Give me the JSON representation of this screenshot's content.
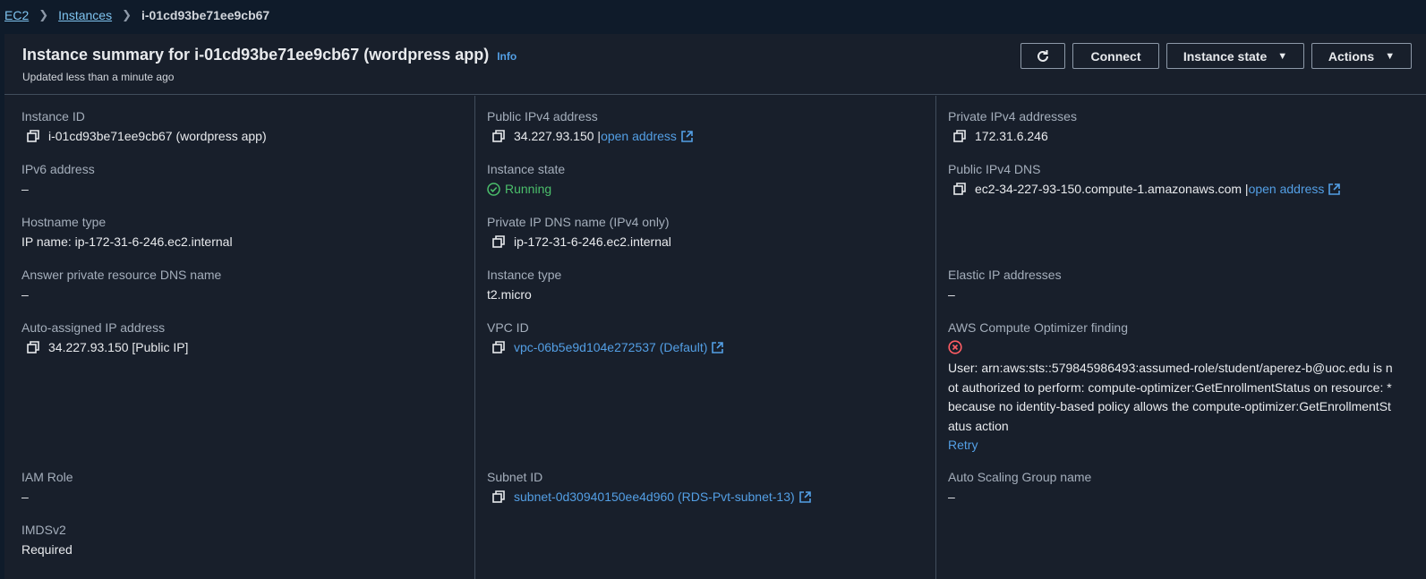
{
  "breadcrumb": {
    "root": "EC2",
    "section": "Instances",
    "current": "i-01cd93be71ee9cb67"
  },
  "header": {
    "title": "Instance summary for i-01cd93be71ee9cb67 (wordpress app)",
    "info": "Info",
    "subtitle": "Updated less than a minute ago",
    "connect": "Connect",
    "instance_state": "Instance state",
    "actions": "Actions"
  },
  "col1": {
    "instance_id_label": "Instance ID",
    "instance_id": "i-01cd93be71ee9cb67 (wordpress app)",
    "ipv6_label": "IPv6 address",
    "ipv6": "–",
    "hostname_type_label": "Hostname type",
    "hostname_type": "IP name: ip-172-31-6-246.ec2.internal",
    "answer_dns_label": "Answer private resource DNS name",
    "answer_dns": "–",
    "auto_ip_label": "Auto-assigned IP address",
    "auto_ip": "34.227.93.150 [Public IP]",
    "iam_label": "IAM Role",
    "iam": "–",
    "imds_label": "IMDSv2",
    "imds": "Required"
  },
  "col2": {
    "public_ipv4_label": "Public IPv4 address",
    "public_ipv4": "34.227.93.150 |",
    "open_address": "open address",
    "state_label": "Instance state",
    "state": "Running",
    "private_dns_label": "Private IP DNS name (IPv4 only)",
    "private_dns": "ip-172-31-6-246.ec2.internal",
    "type_label": "Instance type",
    "type": "t2.micro",
    "vpc_label": "VPC ID",
    "vpc": "vpc-06b5e9d104e272537 (Default)",
    "subnet_label": "Subnet ID",
    "subnet": "subnet-0d30940150ee4d960 (RDS-Pvt-subnet-13)"
  },
  "col3": {
    "private_ipv4_label": "Private IPv4 addresses",
    "private_ipv4": "172.31.6.246",
    "public_dns_label": "Public IPv4 DNS",
    "public_dns": "ec2-34-227-93-150.compute-1.amazonaws.com |",
    "open_address": "open address",
    "elastic_label": "Elastic IP addresses",
    "elastic": "–",
    "optimizer_label": "AWS Compute Optimizer finding",
    "optimizer_error": "User: arn:aws:sts::579845986493:assumed-role/student/aperez-b@uoc.edu is not authorized to perform: compute-optimizer:GetEnrollmentStatus on resource: * because no identity-based policy allows the compute-optimizer:GetEnrollmentStatus action",
    "retry": "Retry",
    "asg_label": "Auto Scaling Group name",
    "asg": "–"
  },
  "colors": {
    "link": "#539fe5",
    "running": "#4bbf6b",
    "error": "#ff5d64",
    "background": "#181f2b"
  },
  "icons": [
    "chevron-right-icon",
    "refresh-icon",
    "caret-down-icon",
    "copy-icon",
    "external-link-icon",
    "check-circle-icon",
    "error-circle-icon"
  ]
}
